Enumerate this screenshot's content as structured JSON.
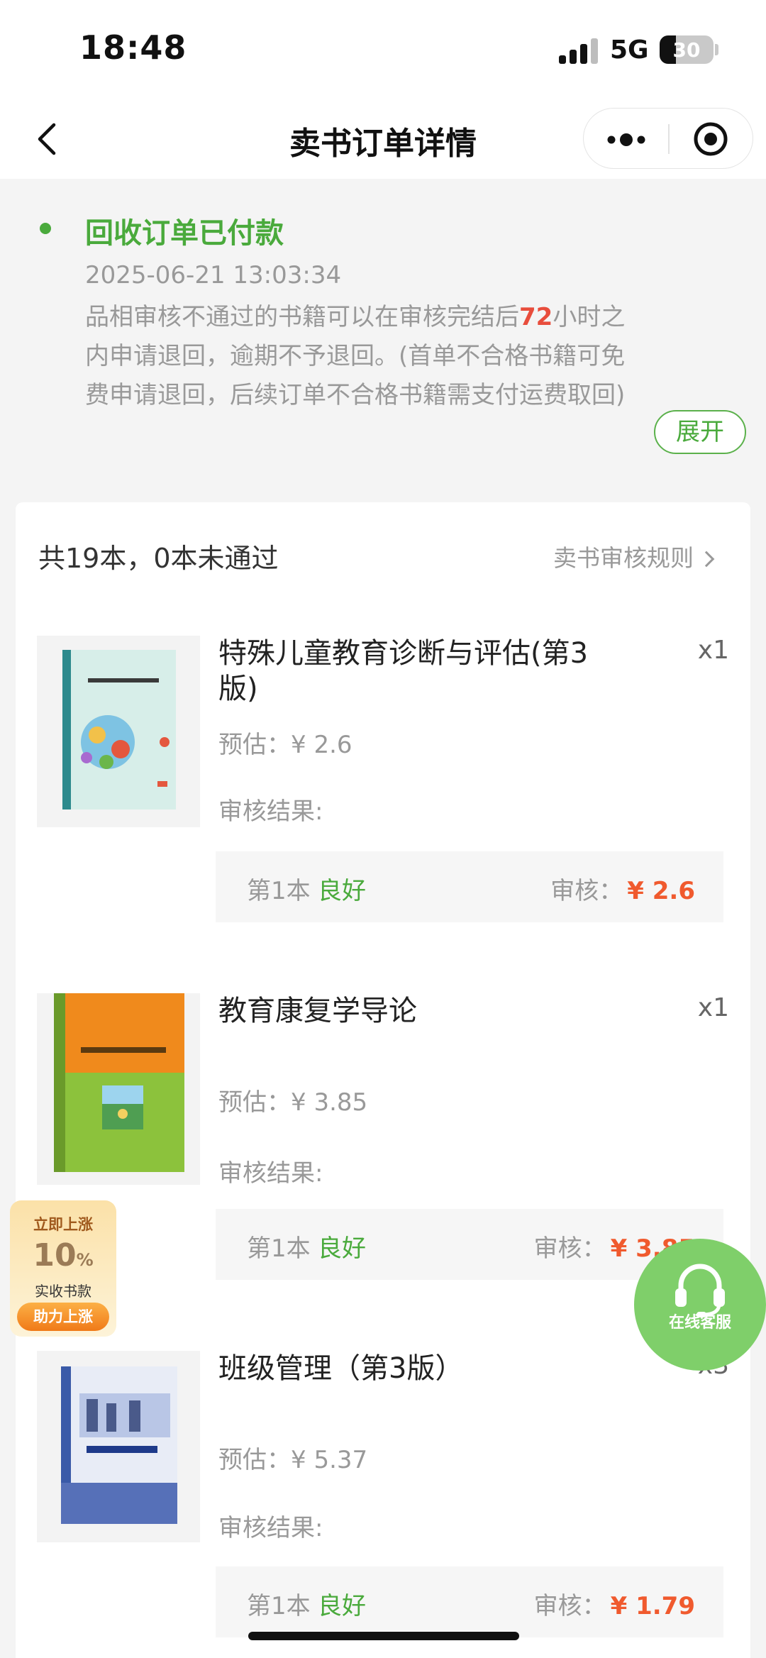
{
  "status_bar": {
    "time": "18:48",
    "network": "5G",
    "battery": "30",
    "battery_level": 0.3
  },
  "nav": {
    "title": "卖书订单详情"
  },
  "order_status": {
    "title": "回收订单已付款",
    "time": "2025-06-21 13:03:34",
    "notice_prefix": "品相审核不通过的书籍可以在审核完结后",
    "notice_hours": "72",
    "notice_suffix": "小时之内申请退回，逾期不予退回。(首单不合格书籍可免费申请退回，后续订单不合格书籍需支付运费取回)",
    "expand_label": "展开"
  },
  "summary": {
    "text": "共19本，0本未通过",
    "rules_link": "卖书审核规则"
  },
  "books": [
    {
      "name": "特殊儿童教育诊断与评估(第3版)",
      "qty": "x1",
      "estimate": "预估：¥ 2.6",
      "audit_label": "审核结果:",
      "result": {
        "index": "第1本",
        "grade": "良好",
        "audit_label": "审核：",
        "audit_price": "¥ 2.6"
      }
    },
    {
      "name": "教育康复学导论",
      "qty": "x1",
      "estimate": "预估：¥ 3.85",
      "audit_label": "审核结果:",
      "result": {
        "index": "第1本",
        "grade": "良好",
        "audit_label": "审核：",
        "audit_price": "¥ 3.85"
      }
    },
    {
      "name": "班级管理（第3版）",
      "qty": "x3",
      "estimate": "预估：¥ 5.37",
      "audit_label": "审核结果:",
      "result": {
        "index": "第1本",
        "grade": "良好",
        "audit_label": "审核：",
        "audit_price": "¥ 1.79"
      }
    }
  ],
  "promo": {
    "top": "立即上涨",
    "num": "10",
    "pct": "%",
    "sub": "实收书款",
    "button": "助力上涨"
  },
  "service": {
    "label": "在线客服"
  },
  "colors": {
    "green": "#4aaa3c",
    "red": "#e84d3c",
    "orange": "#f05a2e"
  }
}
